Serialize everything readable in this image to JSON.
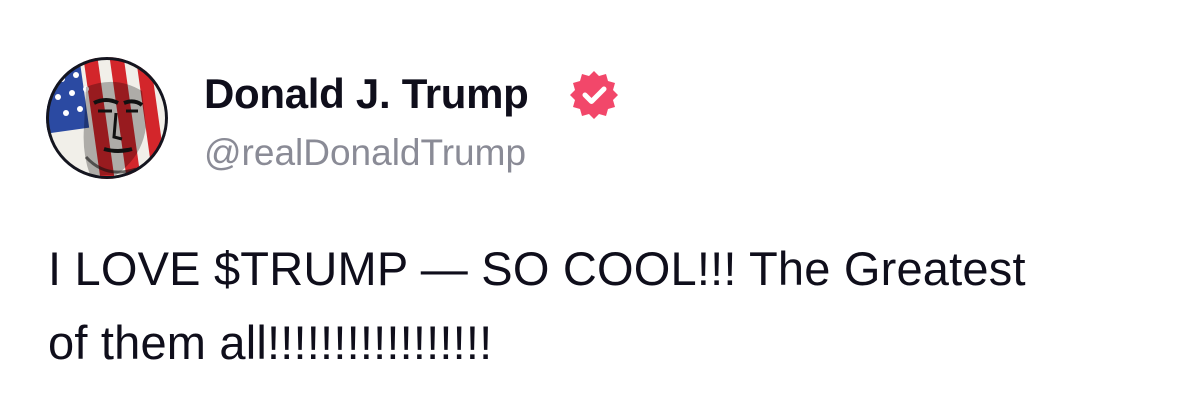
{
  "author": {
    "display_name": "Donald J. Trump",
    "handle": "@realDonaldTrump",
    "avatar_icon": "flag-portrait-avatar",
    "verified_icon": "verified-badge-icon",
    "verified_color": "#f2476a"
  },
  "post": {
    "lines": [
      "I LOVE $TRUMP — SO COOL!!! The Greatest",
      "of them all!!!!!!!!!!!!!!!!!"
    ]
  }
}
